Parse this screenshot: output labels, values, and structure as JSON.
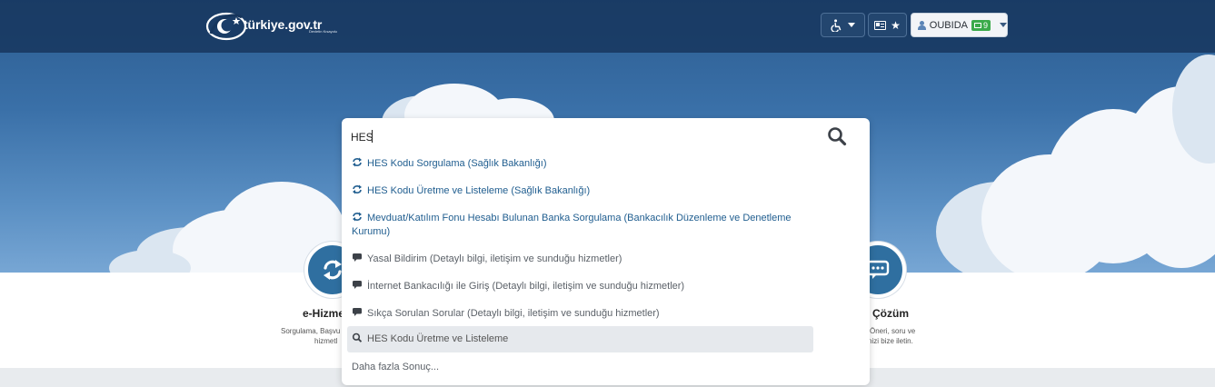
{
  "header": {
    "logo_text": "türkiye.gov.tr",
    "logo_tagline": "Devletin Kısayolu",
    "user": {
      "name": "OUBIDA",
      "message_count": "9"
    }
  },
  "icons": {
    "accessibility": "wheelchair-icon",
    "card": "id-card-icon",
    "favorites": "star-icon",
    "user": "user-icon",
    "messages": "envelope-icon",
    "search": "magnifier-icon"
  },
  "search": {
    "value": "HES",
    "suggestions": [
      {
        "type": "service",
        "icon": "refresh-icon",
        "text": "HES Kodu Sorgulama (Sağlık Bakanlığı)"
      },
      {
        "type": "service",
        "icon": "refresh-icon",
        "text": "HES Kodu Üretme ve Listeleme (Sağlık Bakanlığı)"
      },
      {
        "type": "service",
        "icon": "refresh-icon",
        "text": "Mevduat/Katılım Fonu Hesabı Bulunan Banka Sorgulama (Bankacılık Düzenleme ve Denetleme",
        "text_line2": "Kurumu)"
      },
      {
        "type": "info",
        "icon": "chat-icon",
        "text": "Yasal Bildirim (Detaylı bilgi, iletişim ve sunduğu hizmetler)"
      },
      {
        "type": "info",
        "icon": "chat-icon",
        "text": "İnternet Bankacılığı ile Giriş (Detaylı bilgi, iletişim ve sunduğu hizmetler)"
      },
      {
        "type": "info",
        "icon": "chat-icon",
        "text": "Sıkça Sorulan Sorular (Detaylı bilgi, iletişim ve sunduğu hizmetler)"
      },
      {
        "type": "search",
        "icon": "search-icon",
        "text": "HES Kodu Üretme ve Listeleme"
      }
    ],
    "more_label": "Daha fazla Sonuç..."
  },
  "services": {
    "left": {
      "title": "e-Hizme",
      "desc_line1": "Sorgulama, Başvu",
      "desc_line2": "hizmetl"
    },
    "right": {
      "title": "Çözüm",
      "desc_line1": "Öneri, soru ve",
      "desc_line2": "nizi bize iletin."
    }
  },
  "colors": {
    "topbar": "#16355c",
    "link": "#1f5d8f",
    "badge": "#3aaa4a",
    "circle": "#2f6fa0"
  }
}
